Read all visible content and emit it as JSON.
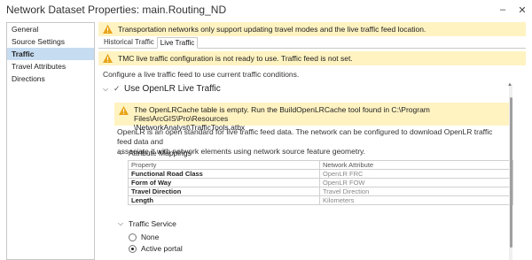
{
  "window": {
    "title": "Network Dataset Properties: main.Routing_ND",
    "minimize_icon": "minimize-icon",
    "close_icon": "close-icon"
  },
  "sidebar": {
    "items": [
      {
        "label": "General",
        "active": false
      },
      {
        "label": "Source Settings",
        "active": false
      },
      {
        "label": "Traffic",
        "active": true
      },
      {
        "label": "Travel Attributes",
        "active": false
      },
      {
        "label": "Directions",
        "active": false
      }
    ]
  },
  "top_warning": "Transportation networks only support updating travel modes and the live traffic feed location.",
  "tabs": [
    {
      "label": "Historical Traffic",
      "active": false
    },
    {
      "label": "Live Traffic",
      "active": true
    }
  ],
  "tmc_warning": "TMC live traffic configuration is not ready to use. Traffic feed is not set.",
  "configure_text": "Configure a live traffic feed to use current traffic conditions.",
  "openlr": {
    "section_label": "Use OpenLR Live Traffic",
    "cache_warning_line1": "The OpenLRCache table is empty. Run the BuildOpenLRCache tool found in C:\\Program Files\\ArcGIS\\Pro\\Resources",
    "cache_warning_line2": "\\NetworkAnalyst\\TrafficTools.atbx",
    "description_line1": "OpenLR is an open standard for live traffic feed data. The network can be configured to download OpenLR traffic feed data and",
    "description_line2": "associate it with network elements using network source feature geometry."
  },
  "attribute_mappings": {
    "label": "Attribute Mappings",
    "headers": [
      "Property",
      "Network Attribute"
    ],
    "rows": [
      {
        "property": "Functional Road Class",
        "attribute": "OpenLR FRC"
      },
      {
        "property": "Form of Way",
        "attribute": "OpenLR FOW"
      },
      {
        "property": "Travel Direction",
        "attribute": "Travel Direction"
      },
      {
        "property": "Length",
        "attribute": "Kilometers"
      }
    ]
  },
  "traffic_service": {
    "label": "Traffic Service",
    "options": [
      {
        "label": "None",
        "selected": false
      },
      {
        "label": "Active portal",
        "selected": true
      }
    ]
  },
  "colors": {
    "warning_bg": "#fff3c2",
    "warning_icon": "#e8a317",
    "selected_item_bg": "#c6dcf1"
  }
}
